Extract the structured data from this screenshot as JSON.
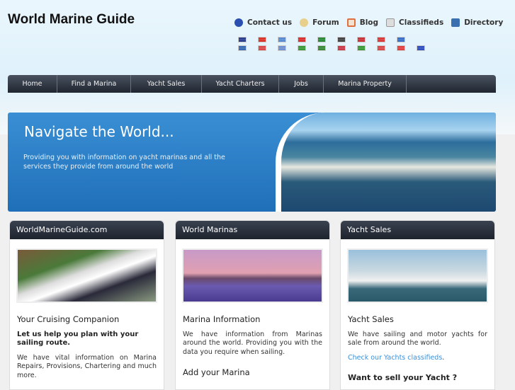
{
  "site_title": "World Marine Guide",
  "top_links": [
    {
      "label": "Contact us",
      "icon": "help-icon",
      "color": "#2a4fb0"
    },
    {
      "label": "Forum",
      "icon": "chat-bubble-icon",
      "color": "#e6d08c"
    },
    {
      "label": "Blog",
      "icon": "blog-icon",
      "color": "#e07040"
    },
    {
      "label": "Classifieds",
      "icon": "newspaper-icon",
      "color": "#bbbbbb"
    },
    {
      "label": "Directory",
      "icon": "book-icon",
      "color": "#3a70b0"
    }
  ],
  "flags_row1": [
    "#2a3e8c",
    "#d8342a",
    "#5a8ad0",
    "#d83030",
    "#2a8a3a",
    "#444444",
    "#c8343a",
    "#d83a3a",
    "#3a70c8"
  ],
  "flags_row2": [
    "#3a6ab0",
    "#d84a4a",
    "#7090d0",
    "#3a9a3a",
    "#3a8a3a",
    "#c83a4a",
    "#3a9a3a",
    "#d84a4a",
    "#e04040",
    "#3050c0"
  ],
  "nav": [
    "Home",
    "Find a Marina",
    "Yacht Sales",
    "Yacht Charters",
    "Jobs",
    "Marina Property"
  ],
  "hero": {
    "title": "Navigate the World...",
    "text": "Providing you with information on yacht marinas and all the services they provide from around the world"
  },
  "panels": [
    {
      "header": "WorldMarineGuide.com",
      "heading": "Your Cruising Companion",
      "bold": "Let us help you plan with your sailing route.",
      "text": "We have vital information on Marina Repairs, Provisions, Chartering and much more."
    },
    {
      "header": "World Marinas",
      "heading": "Marina Information",
      "text": "We have information from Marinas around the world. Providing you with the data you require when sailing.",
      "heading2": "Add your Marina"
    },
    {
      "header": "Yacht Sales",
      "heading": "Yacht Sales",
      "text": "We have sailing and motor yachts for sale from around the world.",
      "link": "Check our Yachts classifieds",
      "link_suffix": ".",
      "heading2": "Want to sell your Yacht ?"
    }
  ]
}
